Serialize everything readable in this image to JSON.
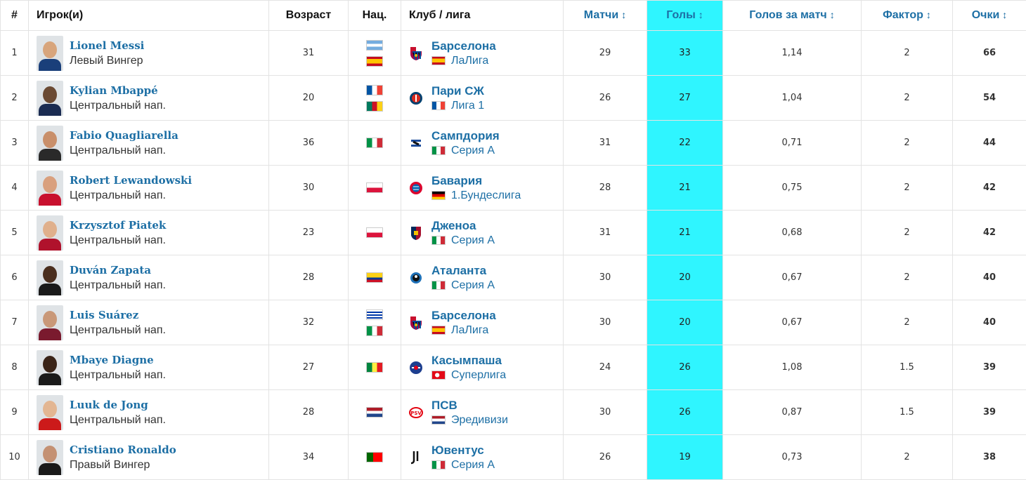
{
  "header": {
    "rank": "#",
    "player": "Игрок(и)",
    "age": "Возраст",
    "nat": "Нац.",
    "club": "Клуб / лига",
    "matches": "Матчи",
    "goals": "Голы",
    "gpm": "Голов за матч",
    "factor": "Фактор",
    "points": "Очки",
    "sort_arrow": "↕"
  },
  "colors": {
    "link": "#1d6fa5",
    "goals_highlight": "#2ff5ff",
    "border": "#e3e3e3"
  },
  "rows": [
    {
      "rank": "1",
      "name": "Lionel Messi",
      "position": "Левый Вингер",
      "age": "31",
      "nations": [
        "argentina-flag",
        "spain-flag"
      ],
      "club": "Барселона",
      "club_icon": "barcelona-crest-icon",
      "league": "ЛаЛига",
      "league_flag": "spain-flag",
      "matches": "29",
      "goals": "33",
      "gpm": "1,14",
      "factor": "2",
      "points": "66"
    },
    {
      "rank": "2",
      "name": "Kylian Mbappé",
      "position": "Центральный нап.",
      "age": "20",
      "nations": [
        "france-flag",
        "cameroon-flag"
      ],
      "club": "Пари СЖ",
      "club_icon": "psg-crest-icon",
      "league": "Лига 1",
      "league_flag": "france-flag",
      "matches": "26",
      "goals": "27",
      "gpm": "1,04",
      "factor": "2",
      "points": "54"
    },
    {
      "rank": "3",
      "name": "Fabio Quagliarella",
      "position": "Центральный нап.",
      "age": "36",
      "nations": [
        "italy-flag"
      ],
      "club": "Сампдория",
      "club_icon": "sampdoria-crest-icon",
      "league": "Серия А",
      "league_flag": "italy-flag",
      "matches": "31",
      "goals": "22",
      "gpm": "0,71",
      "factor": "2",
      "points": "44"
    },
    {
      "rank": "4",
      "name": "Robert Lewandowski",
      "position": "Центральный нап.",
      "age": "30",
      "nations": [
        "poland-flag"
      ],
      "club": "Бавария",
      "club_icon": "bayern-crest-icon",
      "league": "1.Бундеслига",
      "league_flag": "germany-flag",
      "matches": "28",
      "goals": "21",
      "gpm": "0,75",
      "factor": "2",
      "points": "42"
    },
    {
      "rank": "5",
      "name": "Krzysztof Piatek",
      "position": "Центральный нап.",
      "age": "23",
      "nations": [
        "poland-flag"
      ],
      "club": "Дженоа",
      "club_icon": "genoa-crest-icon",
      "league": "Серия А",
      "league_flag": "italy-flag",
      "matches": "31",
      "goals": "21",
      "gpm": "0,68",
      "factor": "2",
      "points": "42"
    },
    {
      "rank": "6",
      "name": "Duván Zapata",
      "position": "Центральный нап.",
      "age": "28",
      "nations": [
        "colombia-flag"
      ],
      "club": "Аталанта",
      "club_icon": "atalanta-crest-icon",
      "league": "Серия А",
      "league_flag": "italy-flag",
      "matches": "30",
      "goals": "20",
      "gpm": "0,67",
      "factor": "2",
      "points": "40"
    },
    {
      "rank": "7",
      "name": "Luis Suárez",
      "position": "Центральный нап.",
      "age": "32",
      "nations": [
        "uruguay-flag",
        "italy-flag"
      ],
      "club": "Барселона",
      "club_icon": "barcelona-crest-icon",
      "league": "ЛаЛига",
      "league_flag": "spain-flag",
      "matches": "30",
      "goals": "20",
      "gpm": "0,67",
      "factor": "2",
      "points": "40"
    },
    {
      "rank": "8",
      "name": "Mbaye Diagne",
      "position": "Центральный нап.",
      "age": "27",
      "nations": [
        "senegal-flag"
      ],
      "club": "Касымпаша",
      "club_icon": "kasimpasa-crest-icon",
      "league": "Суперлига",
      "league_flag": "turkey-flag",
      "matches": "24",
      "goals": "26",
      "gpm": "1,08",
      "factor": "1.5",
      "points": "39"
    },
    {
      "rank": "9",
      "name": "Luuk de Jong",
      "position": "Центральный нап.",
      "age": "28",
      "nations": [
        "netherlands-flag"
      ],
      "club": "ПСВ",
      "club_icon": "psv-crest-icon",
      "league": "Эредивизи",
      "league_flag": "netherlands-flag",
      "matches": "30",
      "goals": "26",
      "gpm": "0,87",
      "factor": "1.5",
      "points": "39"
    },
    {
      "rank": "10",
      "name": "Cristiano Ronaldo",
      "position": "Правый Вингер",
      "age": "34",
      "nations": [
        "portugal-flag"
      ],
      "club": "Ювентус",
      "club_icon": "juventus-crest-icon",
      "league": "Серия А",
      "league_flag": "italy-flag",
      "matches": "26",
      "goals": "19",
      "gpm": "0,73",
      "factor": "2",
      "points": "38"
    }
  ]
}
